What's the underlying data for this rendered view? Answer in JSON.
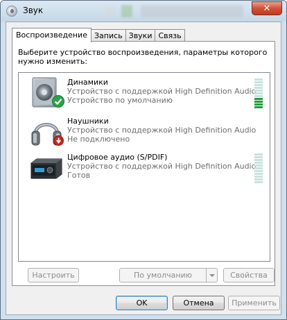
{
  "window": {
    "title": "Звук",
    "close_label": "✕"
  },
  "tabs": [
    {
      "label": "Воспроизведение",
      "active": true
    },
    {
      "label": "Запись",
      "active": false
    },
    {
      "label": "Звуки",
      "active": false
    },
    {
      "label": "Связь",
      "active": false
    }
  ],
  "panel": {
    "description": "Выберите устройство воспроизведения, параметры которого нужно изменить:"
  },
  "devices": [
    {
      "name": "Динамики",
      "detail": "Устройство с поддержкой High Definition Audio",
      "status": "Устройство по умолчанию",
      "icon": "speaker-icon",
      "badge": "default-check-icon",
      "level": 0.35
    },
    {
      "name": "Наушники",
      "detail": "Устройство с поддержкой High Definition Audio",
      "status": "Не подключено",
      "icon": "headphones-icon",
      "badge": "unplugged-arrow-icon"
    },
    {
      "name": "Цифровое аудио (S/PDIF)",
      "detail": "Устройство с поддержкой High Definition Audio",
      "status": "Готов",
      "icon": "digital-audio-receiver-icon",
      "level": 0
    }
  ],
  "panel_buttons": {
    "configure": "Настроить",
    "default": "По умолчанию",
    "properties": "Свойства"
  },
  "dialog_buttons": {
    "ok": "OK",
    "cancel": "Отмена",
    "apply": "Применить"
  },
  "colors": {
    "accent_check": "#2aa34a",
    "meter_on": "#1e9e3a",
    "meter_off": "#c9e2de",
    "unplugged_badge": "#c8281e"
  }
}
